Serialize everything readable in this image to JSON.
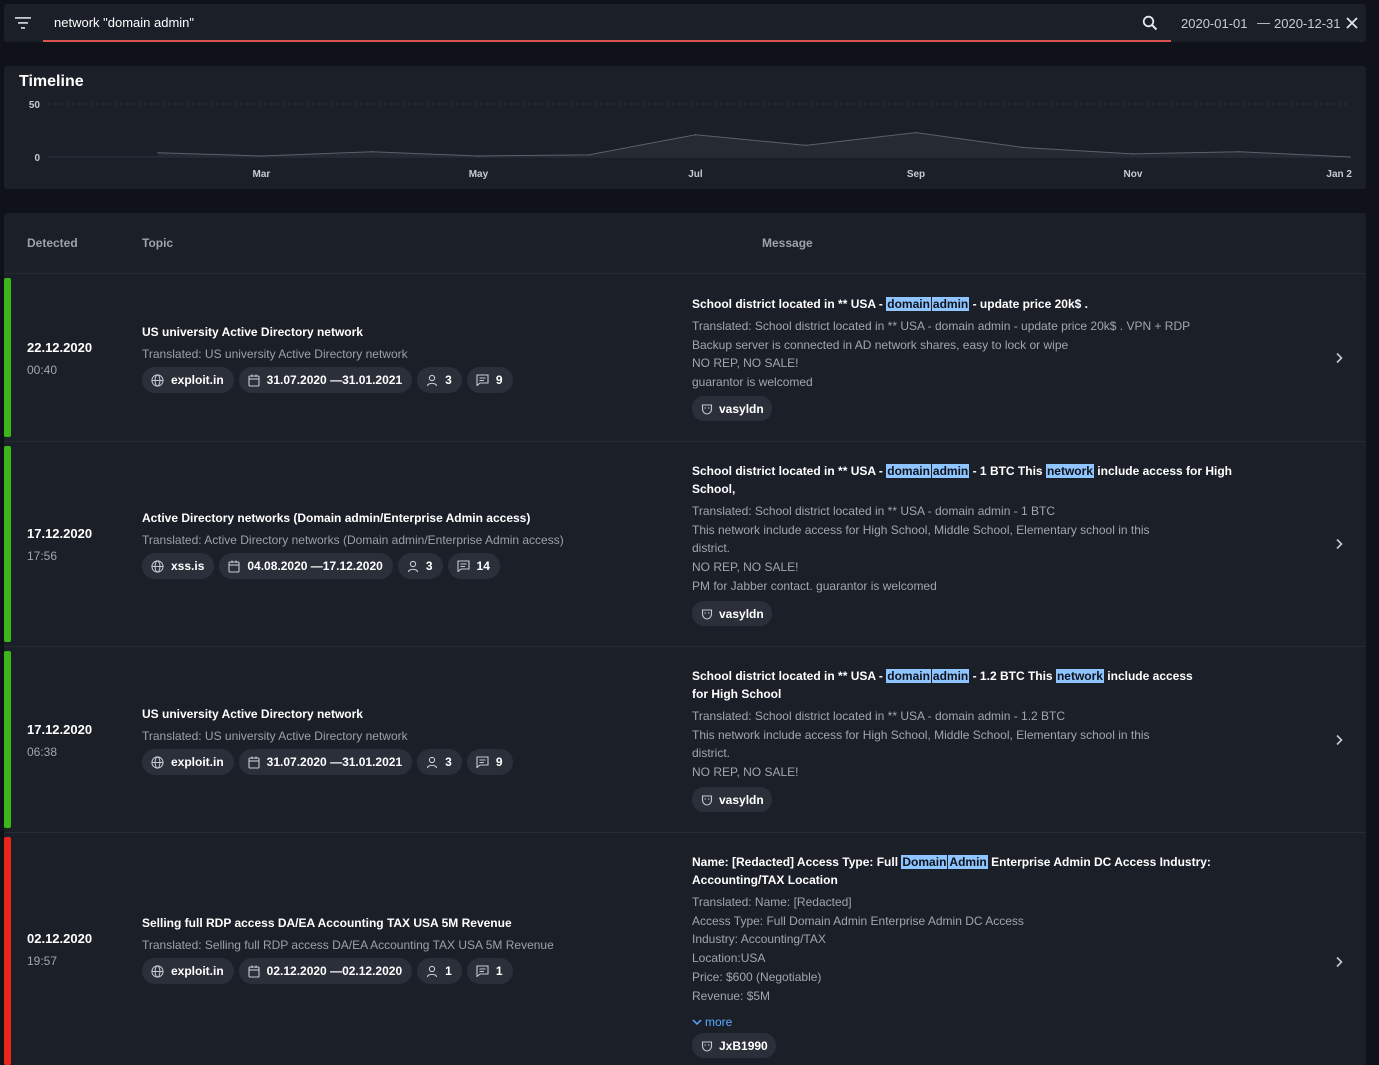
{
  "search": {
    "query": "network \"domain admin\"",
    "date_from": "2020-01-01",
    "date_separator": "—",
    "date_to": "2020-12-31"
  },
  "timeline": {
    "title": "Timeline"
  },
  "chart_data": {
    "type": "area",
    "title": "Timeline",
    "x": [
      "2020-02-01",
      "2020-03-01",
      "2020-04-01",
      "2020-05-01",
      "2020-06-01",
      "2020-07-01",
      "2020-08-01",
      "2020-09-01",
      "2020-10-01",
      "2020-11-01",
      "2020-12-01",
      "2021-01-01"
    ],
    "values": [
      4,
      1,
      5,
      1,
      2,
      21,
      11,
      23,
      9,
      3,
      5,
      0
    ],
    "ylim": [
      0,
      50
    ],
    "yticks": [
      "0",
      "50"
    ],
    "xticks": [
      "Mar",
      "May",
      "Jul",
      "Sep",
      "Nov",
      "Jan 2"
    ],
    "grid": true,
    "color": "#5b606a"
  },
  "table": {
    "headers": {
      "detected": "Detected",
      "topic": "Topic",
      "message": "Message"
    },
    "rows": [
      {
        "status_color": "#3fb618",
        "date": "22.12.2020",
        "time": "00:40",
        "topic": "US university Active Directory network",
        "topic_translated": "Translated: US university Active Directory network",
        "forum": "exploit.in",
        "period": "31.07.2020 —31.01.2021",
        "users": "3",
        "posts": "9",
        "title_parts": [
          "School district located in ** USA - ",
          "domain",
          "admin",
          " - update price 20k$ ."
        ],
        "body": [
          "Translated: School district located in ** USA - domain admin - update price 20k$ . VPN + RDP",
          "Backup server is connected in AD network shares, easy to lock or wipe",
          "NO REP, NO SALE!",
          "guarantor is welcomed"
        ],
        "author": "vasyldn"
      },
      {
        "status_color": "#3fb618",
        "date": "17.12.2020",
        "time": "17:56",
        "topic": "Active Directory networks (Domain admin/Enterprise Admin access)",
        "topic_translated": "Translated: Active Directory networks (Domain admin/Enterprise Admin access)",
        "forum": "xss.is",
        "period": "04.08.2020 —17.12.2020",
        "users": "3",
        "posts": "14",
        "title_parts": [
          "School district located in ** USA - ",
          "domain",
          "admin",
          " - 1 BTC This ",
          "network",
          " include access for High School,"
        ],
        "body": [
          "Translated: School district located in ** USA - domain admin - 1 BTC",
          "This network include access for High School, Middle School, Elementary school in this district.",
          "NO REP, NO SALE!",
          "PM for Jabber contact. guarantor is welcomed"
        ],
        "author": "vasyldn"
      },
      {
        "status_color": "#3fb618",
        "date": "17.12.2020",
        "time": "06:38",
        "topic": "US university Active Directory network",
        "topic_translated": "Translated: US university Active Directory network",
        "forum": "exploit.in",
        "period": "31.07.2020 —31.01.2021",
        "users": "3",
        "posts": "9",
        "title_parts": [
          "School district located in ** USA - ",
          "domain",
          "admin",
          " - 1.2 BTC This ",
          "network",
          " include access for High School"
        ],
        "body": [
          "Translated: School district located in ** USA - domain admin - 1.2 BTC",
          "This network include access for High School, Middle School, Elementary school in this district.",
          "NO REP, NO SALE!"
        ],
        "author": "vasyldn"
      },
      {
        "status_color": "#e8271a",
        "date": "02.12.2020",
        "time": "19:57",
        "topic": "Selling full RDP access DA/EA Accounting TAX USA 5M Revenue",
        "topic_translated": "Translated: Selling full RDP access DA/EA Accounting TAX USA 5M Revenue",
        "forum": "exploit.in",
        "period": "02.12.2020 —02.12.2020",
        "users": "1",
        "posts": "1",
        "title_parts": [
          "Name: [Redacted] Access Type: Full ",
          "Domain",
          "Admin",
          " Enterprise Admin DC Access Industry: Accounting/TAX Location"
        ],
        "body": [
          "Translated: Name: [Redacted]",
          "Access Type: Full Domain Admin Enterprise Admin DC Access",
          "Industry: Accounting/TAX",
          "Location:USA",
          "Price: $600 (Negotiable)",
          "Revenue: $5M"
        ],
        "more_label": "more",
        "author": "JxB1990"
      }
    ]
  }
}
